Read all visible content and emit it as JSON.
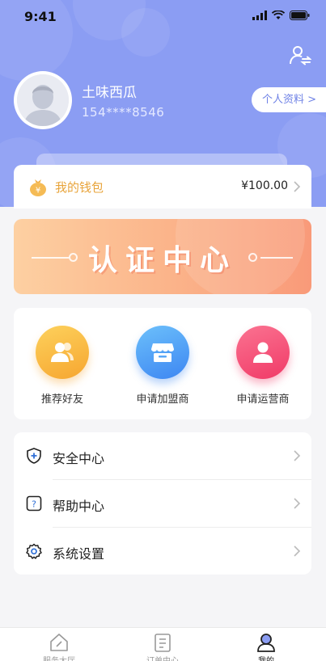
{
  "status_bar": {
    "time": "9:41"
  },
  "user": {
    "name": "土味西瓜",
    "phone": "154****8546"
  },
  "profile_button": "个人资料 >",
  "wallet": {
    "label": "我的钱包",
    "amount": "¥100.00"
  },
  "banner": {
    "title": "认证中心"
  },
  "actions": [
    {
      "label": "推荐好友",
      "color": "#f9b83c"
    },
    {
      "label": "申请加盟商",
      "color": "#4f9cf7"
    },
    {
      "label": "申请运营商",
      "color": "#f5517a"
    }
  ],
  "menu": [
    {
      "label": "安全中心",
      "icon": "shield-plus-icon"
    },
    {
      "label": "帮助中心",
      "icon": "help-icon"
    },
    {
      "label": "系统设置",
      "icon": "gear-icon"
    }
  ],
  "tabbar": [
    {
      "label": "服务大厅",
      "icon": "house-icon",
      "active": false
    },
    {
      "label": "订单中心",
      "icon": "clipboard-icon",
      "active": false
    },
    {
      "label": "我的",
      "icon": "user-icon",
      "active": true
    }
  ],
  "colors": {
    "header": "#8b9df3",
    "accent": "#6f82e6",
    "wallet_text": "#e8a43b"
  }
}
